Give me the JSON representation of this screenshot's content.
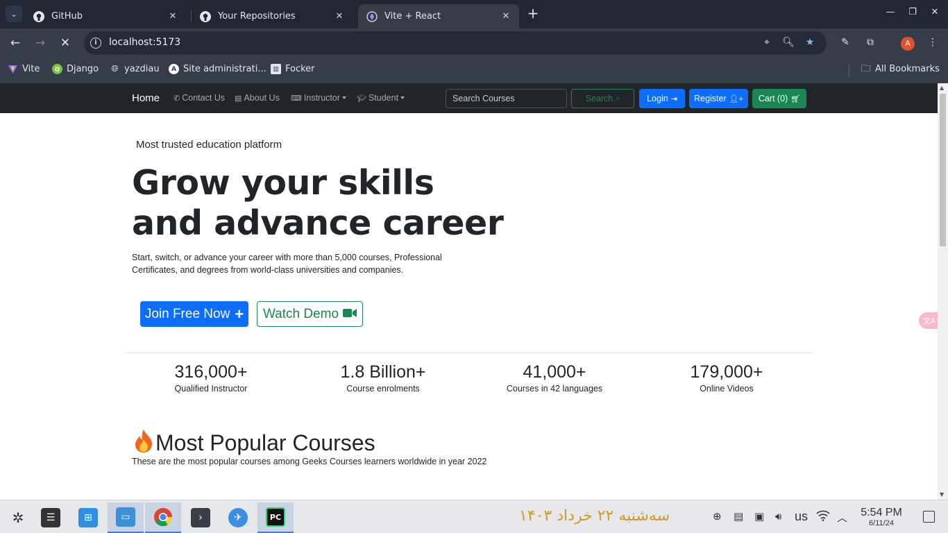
{
  "browser": {
    "tabs": [
      {
        "title": "GitHub",
        "active": false
      },
      {
        "title": "Your Repositories",
        "active": false
      },
      {
        "title": "Vite + React",
        "active": true
      }
    ],
    "url": "localhost:5173",
    "profile_initial": "A",
    "bookmarks": [
      "Vite",
      "Django",
      "yazdiau",
      "Site administrati...",
      "Focker"
    ],
    "all_bookmarks": "All Bookmarks"
  },
  "site": {
    "nav": {
      "brand": "Home",
      "contact": "Contact Us",
      "about": "About Us",
      "instructor": "Instructor",
      "student": "Student",
      "search_placeholder": "Search Courses",
      "search_btn": "Search",
      "login_btn": "Login",
      "register_btn": "Register",
      "cart_btn": "Cart (0)"
    },
    "hero": {
      "eyebrow": "Most trusted education platform",
      "title_line1": "Grow your skills",
      "title_line2": "and advance career",
      "subtitle": "Start, switch, or advance your career with more than 5,000 courses, Professional Certificates, and degrees from world-class universities and companies.",
      "join_btn": "Join Free Now",
      "demo_btn": "Watch Demo"
    },
    "stats": [
      {
        "value": "316,000+",
        "label": "Qualified Instructor"
      },
      {
        "value": "1.8 Billion+",
        "label": "Course enrolments"
      },
      {
        "value": "41,000+",
        "label": "Courses in 42 languages"
      },
      {
        "value": "179,000+",
        "label": "Online Videos"
      }
    ],
    "popular": {
      "title": "Most Popular Courses",
      "subtitle": "These are the most popular courses among Geeks Courses learners worldwide in year 2022"
    }
  },
  "taskbar": {
    "persian_date": "سه‌شنبه ۲۲ خرداد ۱۴۰۳",
    "keyboard_layout": "us",
    "time": "5:54 PM",
    "date": "6/11/24"
  },
  "colors": {
    "primary": "#0d6efd",
    "success": "#198754",
    "navbar": "#212529",
    "chrome_tabbar": "#1f2733",
    "chrome_toolbar": "#353d49"
  }
}
